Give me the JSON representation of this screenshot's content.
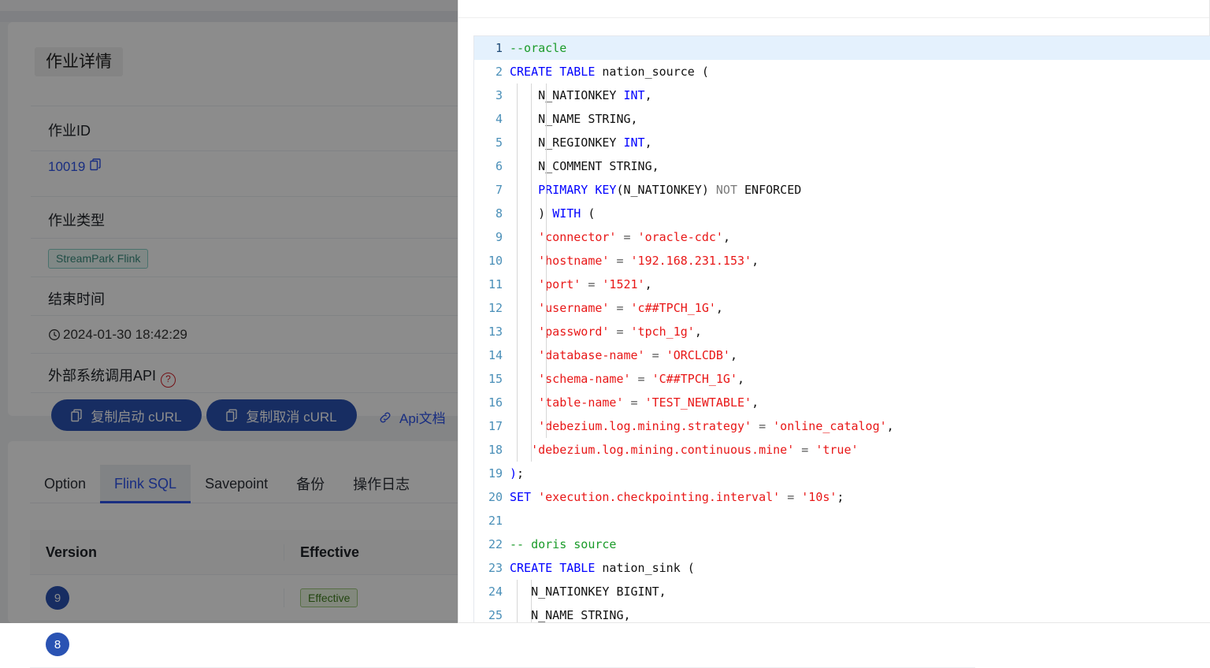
{
  "detail": {
    "title": "作业详情",
    "rows": [
      {
        "label": "作业ID",
        "value": "10019",
        "icon": "copy-icon"
      },
      {
        "label": "作业类型",
        "value": "StreamPark Flink"
      },
      {
        "label": "结束时间",
        "value": "2024-01-30 18:42:29",
        "icon": "clock-icon"
      },
      {
        "label": "外部系统调用API",
        "icon": "help-circle-icon"
      }
    ],
    "actions": {
      "copy_start_curl": "复制启动 cURL",
      "copy_cancel_curl": "复制取消 cURL",
      "api_doc": "Api文档"
    }
  },
  "tabs": {
    "items": [
      "Option",
      "Flink SQL",
      "Savepoint",
      "备份",
      "操作日志"
    ],
    "active": "Flink SQL"
  },
  "version_table": {
    "headers": [
      "Version",
      "Effective"
    ],
    "rows": [
      {
        "version": "9",
        "effective": "Effective"
      },
      {
        "version": "8",
        "effective": ""
      }
    ]
  },
  "editor": {
    "active_line": 1,
    "lines": [
      {
        "n": 1,
        "guides": 0,
        "tokens": [
          {
            "t": "--oracle",
            "c": "c"
          }
        ]
      },
      {
        "n": 2,
        "guides": 0,
        "tokens": [
          {
            "t": "CREATE TABLE",
            "c": "k"
          },
          {
            "t": " nation_source (",
            "c": "p"
          }
        ]
      },
      {
        "n": 3,
        "guides": 3,
        "tokens": [
          {
            "t": "    N_NATIONKEY ",
            "c": "p"
          },
          {
            "t": "INT",
            "c": "t"
          },
          {
            "t": ",",
            "c": "p"
          }
        ]
      },
      {
        "n": 4,
        "guides": 3,
        "tokens": [
          {
            "t": "    N_NAME STRING,",
            "c": "p"
          }
        ]
      },
      {
        "n": 5,
        "guides": 3,
        "tokens": [
          {
            "t": "    N_REGIONKEY ",
            "c": "p"
          },
          {
            "t": "INT",
            "c": "t"
          },
          {
            "t": ",",
            "c": "p"
          }
        ]
      },
      {
        "n": 6,
        "guides": 3,
        "tokens": [
          {
            "t": "    N_COMMENT STRING,",
            "c": "p"
          }
        ]
      },
      {
        "n": 7,
        "guides": 3,
        "tokens": [
          {
            "t": "    ",
            "c": "p"
          },
          {
            "t": "PRIMARY KEY",
            "c": "k"
          },
          {
            "t": "(N_NATIONKEY) ",
            "c": "p"
          },
          {
            "t": "NOT",
            "c": "k2"
          },
          {
            "t": " ENFORCED",
            "c": "p"
          }
        ]
      },
      {
        "n": 8,
        "guides": 3,
        "tokens": [
          {
            "t": "    ) ",
            "c": "p"
          },
          {
            "t": "WITH",
            "c": "k"
          },
          {
            "t": " (",
            "c": "p"
          }
        ]
      },
      {
        "n": 9,
        "guides": 3,
        "tokens": [
          {
            "t": "    ",
            "c": "p"
          },
          {
            "t": "'connector'",
            "c": "s"
          },
          {
            "t": " = ",
            "c": "op"
          },
          {
            "t": "'oracle-cdc'",
            "c": "s"
          },
          {
            "t": ",",
            "c": "p"
          }
        ]
      },
      {
        "n": 10,
        "guides": 3,
        "tokens": [
          {
            "t": "    ",
            "c": "p"
          },
          {
            "t": "'hostname'",
            "c": "s"
          },
          {
            "t": " = ",
            "c": "op"
          },
          {
            "t": "'192.168.231.153'",
            "c": "s"
          },
          {
            "t": ",",
            "c": "p"
          }
        ]
      },
      {
        "n": 11,
        "guides": 3,
        "tokens": [
          {
            "t": "    ",
            "c": "p"
          },
          {
            "t": "'port'",
            "c": "s"
          },
          {
            "t": " = ",
            "c": "op"
          },
          {
            "t": "'1521'",
            "c": "s"
          },
          {
            "t": ",",
            "c": "p"
          }
        ]
      },
      {
        "n": 12,
        "guides": 3,
        "tokens": [
          {
            "t": "    ",
            "c": "p"
          },
          {
            "t": "'username'",
            "c": "s"
          },
          {
            "t": " = ",
            "c": "op"
          },
          {
            "t": "'c##TPCH_1G'",
            "c": "s"
          },
          {
            "t": ",",
            "c": "p"
          }
        ]
      },
      {
        "n": 13,
        "guides": 3,
        "tokens": [
          {
            "t": "    ",
            "c": "p"
          },
          {
            "t": "'password'",
            "c": "s"
          },
          {
            "t": " = ",
            "c": "op"
          },
          {
            "t": "'tpch_1g'",
            "c": "s"
          },
          {
            "t": ",",
            "c": "p"
          }
        ]
      },
      {
        "n": 14,
        "guides": 3,
        "tokens": [
          {
            "t": "    ",
            "c": "p"
          },
          {
            "t": "'database-name'",
            "c": "s"
          },
          {
            "t": " = ",
            "c": "op"
          },
          {
            "t": "'ORCLCDB'",
            "c": "s"
          },
          {
            "t": ",",
            "c": "p"
          }
        ]
      },
      {
        "n": 15,
        "guides": 3,
        "tokens": [
          {
            "t": "    ",
            "c": "p"
          },
          {
            "t": "'schema-name'",
            "c": "s"
          },
          {
            "t": " = ",
            "c": "op"
          },
          {
            "t": "'C##TPCH_1G'",
            "c": "s"
          },
          {
            "t": ",",
            "c": "p"
          }
        ]
      },
      {
        "n": 16,
        "guides": 3,
        "tokens": [
          {
            "t": "    ",
            "c": "p"
          },
          {
            "t": "'table-name'",
            "c": "s"
          },
          {
            "t": " = ",
            "c": "op"
          },
          {
            "t": "'TEST_NEWTABLE'",
            "c": "s"
          },
          {
            "t": ",",
            "c": "p"
          }
        ]
      },
      {
        "n": 17,
        "guides": 3,
        "tokens": [
          {
            "t": "    ",
            "c": "p"
          },
          {
            "t": "'debezium.log.mining.strategy'",
            "c": "s"
          },
          {
            "t": " = ",
            "c": "op"
          },
          {
            "t": "'online_catalog'",
            "c": "s"
          },
          {
            "t": ",",
            "c": "p"
          }
        ]
      },
      {
        "n": 18,
        "guides": 2,
        "tokens": [
          {
            "t": "   ",
            "c": "p"
          },
          {
            "t": "'debezium.log.mining.continuous.mine'",
            "c": "s"
          },
          {
            "t": " = ",
            "c": "op"
          },
          {
            "t": "'true'",
            "c": "s"
          }
        ]
      },
      {
        "n": 19,
        "guides": 0,
        "tokens": [
          {
            "t": ")",
            "c": "k"
          },
          {
            "t": ";",
            "c": "p"
          }
        ]
      },
      {
        "n": 20,
        "guides": 0,
        "tokens": [
          {
            "t": "SET",
            "c": "k"
          },
          {
            "t": " ",
            "c": "p"
          },
          {
            "t": "'execution.checkpointing.interval'",
            "c": "s"
          },
          {
            "t": " = ",
            "c": "op"
          },
          {
            "t": "'10s'",
            "c": "s"
          },
          {
            "t": ";",
            "c": "p"
          }
        ]
      },
      {
        "n": 21,
        "guides": 0,
        "tokens": [
          {
            "t": "",
            "c": "p"
          }
        ]
      },
      {
        "n": 22,
        "guides": 0,
        "tokens": [
          {
            "t": "-- doris source",
            "c": "c"
          }
        ]
      },
      {
        "n": 23,
        "guides": 0,
        "tokens": [
          {
            "t": "CREATE TABLE",
            "c": "k"
          },
          {
            "t": " nation_sink (",
            "c": "p"
          }
        ]
      },
      {
        "n": 24,
        "guides": 2,
        "tokens": [
          {
            "t": "   N_NATIONKEY BIGINT,",
            "c": "p"
          }
        ]
      },
      {
        "n": 25,
        "guides": 2,
        "tokens": [
          {
            "t": "   N_NAME STRING,",
            "c": "p"
          }
        ]
      }
    ]
  }
}
